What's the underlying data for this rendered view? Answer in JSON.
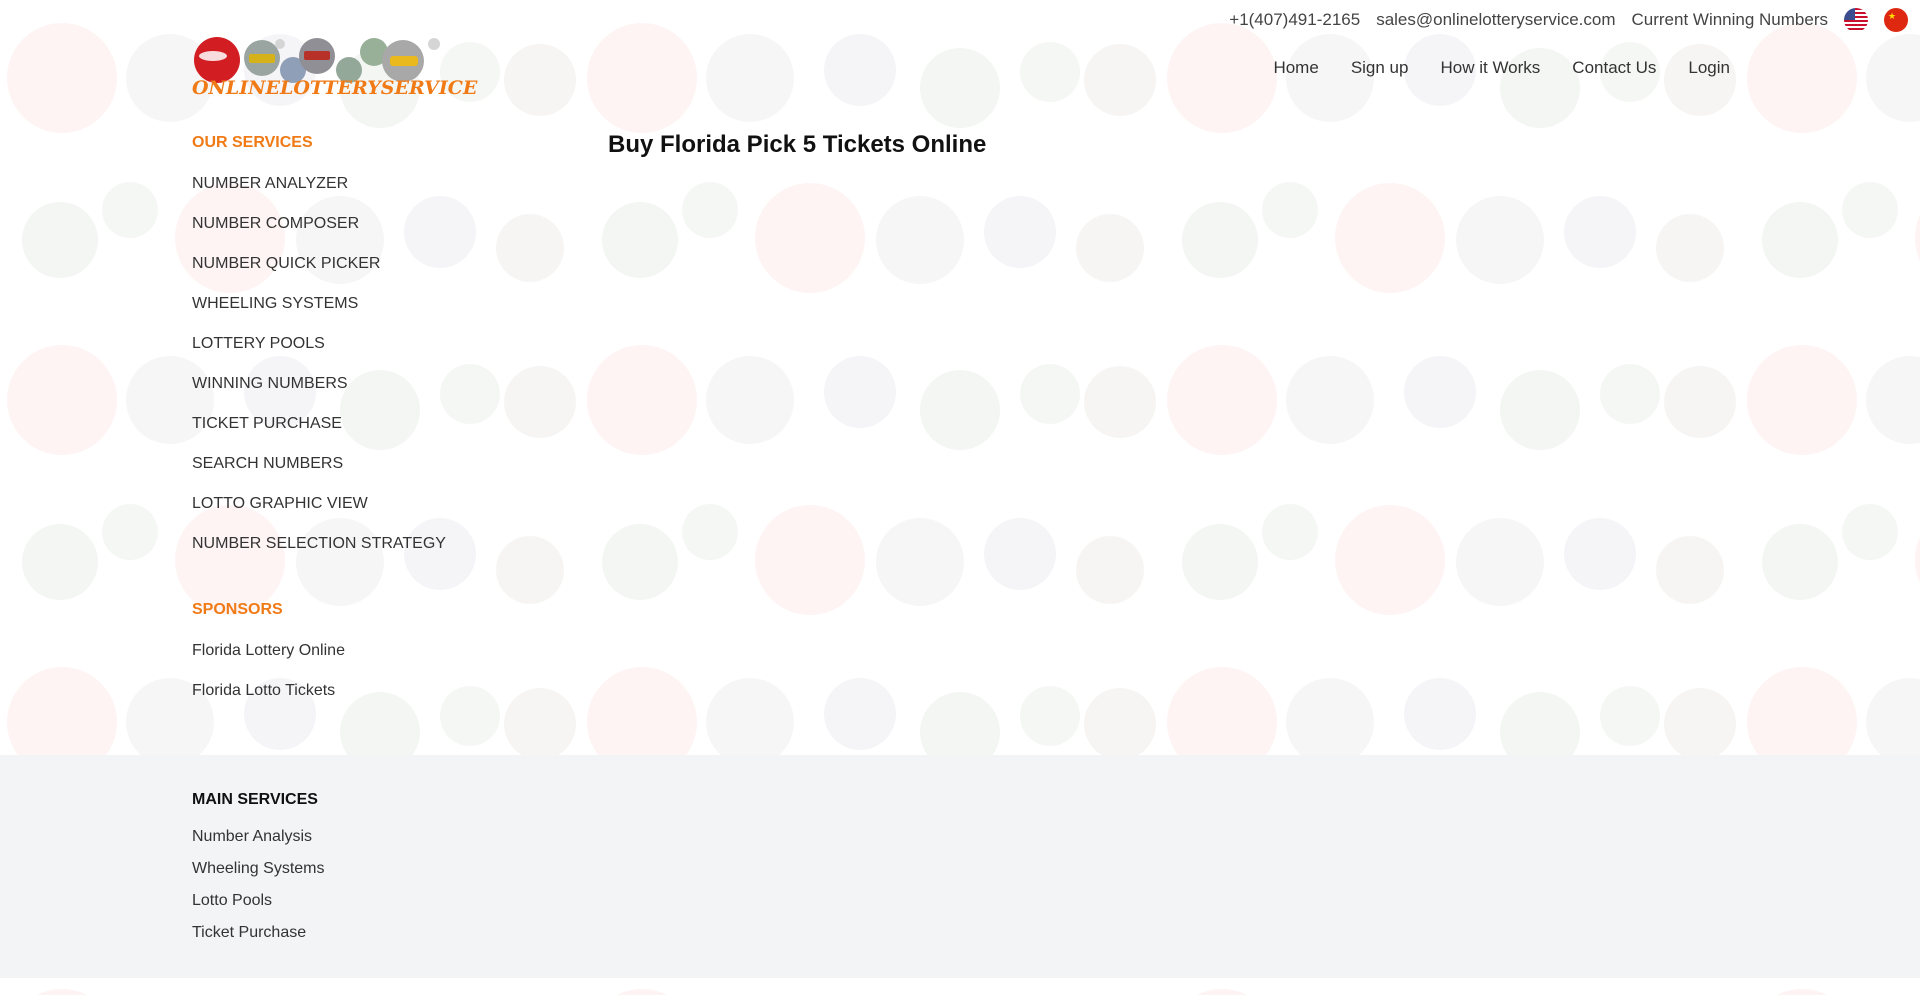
{
  "topbar": {
    "phone": "+1(407)491-2165",
    "email": "sales@onlinelotteryservice.com",
    "winning_link": "Current Winning Numbers",
    "flags": [
      "us-flag-icon",
      "china-flag-icon"
    ]
  },
  "logo": {
    "text": "ONLINELOTTERYSERVICE"
  },
  "nav": {
    "home": "Home",
    "signup": "Sign up",
    "how": "How it Works",
    "contact": "Contact Us",
    "login": "Login"
  },
  "page": {
    "title": "Buy Florida Pick 5 Tickets Online"
  },
  "sidebar": {
    "services_heading": "OUR SERVICES",
    "services": [
      "NUMBER ANALYZER",
      "NUMBER COMPOSER",
      "NUMBER QUICK PICKER",
      "WHEELING SYSTEMS",
      "LOTTERY POOLS",
      "WINNING NUMBERS",
      "TICKET PURCHASE",
      "SEARCH NUMBERS",
      "LOTTO GRAPHIC VIEW",
      "NUMBER SELECTION STRATEGY"
    ],
    "sponsors_heading": "SPONSORS",
    "sponsors": [
      "Florida Lottery Online",
      "Florida Lotto Tickets"
    ]
  },
  "footer": {
    "heading": "MAIN SERVICES",
    "items": [
      "Number Analysis",
      "Wheeling Systems",
      "Lotto Pools",
      "Ticket Purchase"
    ]
  },
  "colors": {
    "accent": "#f07a16",
    "footer_bg": "#f3f4f5"
  }
}
